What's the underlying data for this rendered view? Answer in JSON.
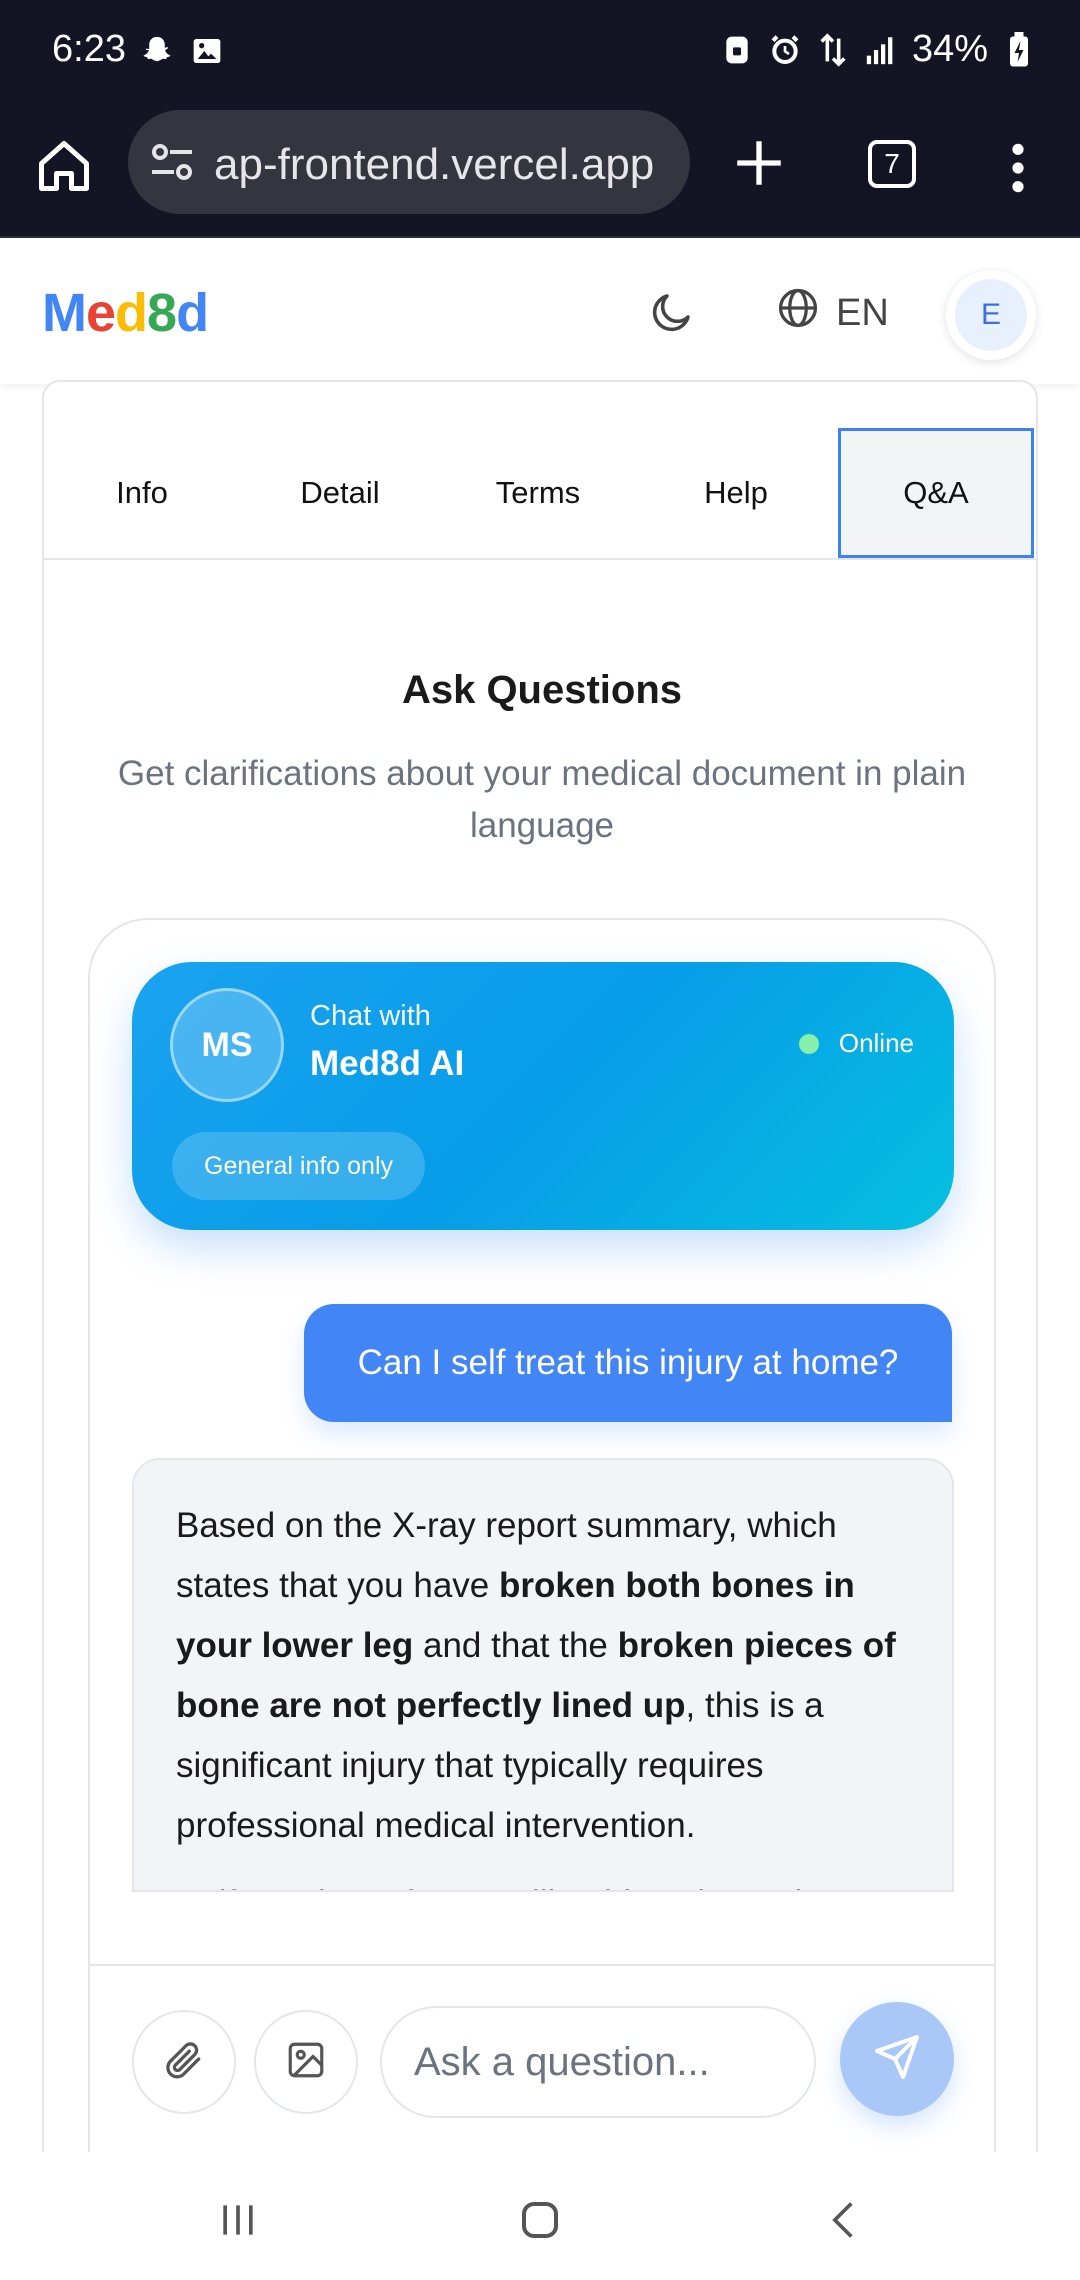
{
  "status_bar": {
    "time": "6:23",
    "battery": "34%"
  },
  "browser": {
    "url": "ap-frontend.vercel.app",
    "tab_count": "7"
  },
  "app": {
    "logo": {
      "m": "M",
      "e": "e",
      "d1": "d",
      "n8": "8",
      "d2": "d"
    },
    "language": "EN",
    "avatar_initial": "E"
  },
  "tabs": [
    {
      "label": "Info"
    },
    {
      "label": "Detail"
    },
    {
      "label": "Terms"
    },
    {
      "label": "Help"
    },
    {
      "label": "Q&A",
      "active": true
    }
  ],
  "section": {
    "title": "Ask Questions",
    "subtitle": "Get clarifications about your medical document in plain language"
  },
  "chat": {
    "avatar_initials": "MS",
    "chat_with": "Chat with",
    "bot_name": "Med8d AI",
    "status": "Online",
    "disclaimer_pill": "General info only",
    "user_message": "Can I self treat this injury at home?",
    "ai_message": {
      "p1_a": "Based on the X-ray report summary, which states that you have ",
      "p1_b": "broken both bones in your lower leg",
      "p1_c": " and that the ",
      "p1_d": "broken pieces of bone are not perfectly lined up",
      "p1_e": ", this is a significant injury that typically requires professional medical intervention.",
      "p2": "Self-treating a fracture like this at home is"
    },
    "input_placeholder": "Ask a question..."
  },
  "colors": {
    "accent_blue": "#4285f4",
    "header_gradient_start": "#1aa2f0",
    "header_gradient_end": "#06bfe0",
    "online_dot": "#86efac",
    "send_button": "#a9c8f8"
  }
}
